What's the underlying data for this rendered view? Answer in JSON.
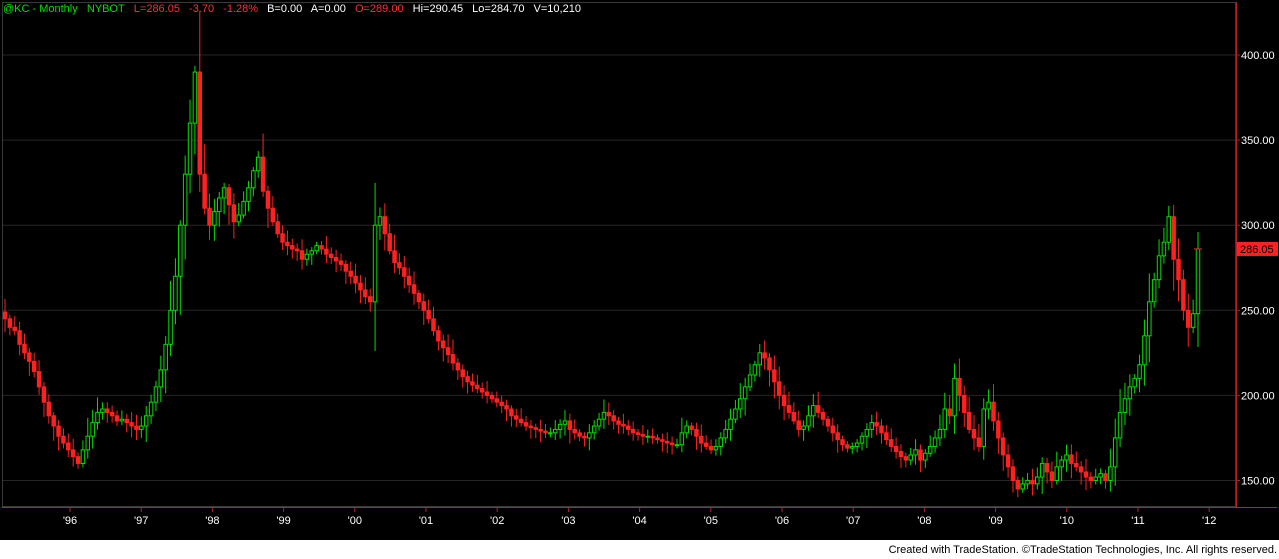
{
  "header": {
    "symbol": "@KC - Monthly",
    "exchange": "NYBOT",
    "last": "L=286.05",
    "change": "-3.70",
    "change_pct": "-1.28%",
    "bid": "B=0.00",
    "ask": "A=0.00",
    "open": "O=289.00",
    "high": "Hi=290.45",
    "low": "Lo=284.70",
    "volume": "V=10,210"
  },
  "footer": {
    "text": "Created with TradeStation. ©TradeStation Technologies, Inc. All rights reserved."
  },
  "colors": {
    "up": "#00e000",
    "down": "#ff2020",
    "axis": "#b22222",
    "grid": "#262626",
    "last_price_tag": "#ff2020"
  },
  "chart_data": {
    "type": "candlestick",
    "interval": "monthly",
    "ylim": [
      135,
      430
    ],
    "y_ticks": [
      150,
      200,
      250,
      300,
      350,
      400
    ],
    "y_tick_labels": [
      "150.00",
      "200.00",
      "250.00",
      "300.00",
      "350.00",
      "400.00"
    ],
    "x_tick_labels": [
      "'96",
      "'97",
      "'98",
      "'99",
      "'00",
      "'01",
      "'02",
      "'03",
      "'04",
      "'05",
      "'06",
      "'07",
      "'08",
      "'09",
      "'10",
      "'11",
      "'12"
    ],
    "last_price_label": "286.05",
    "last_price": 286.05,
    "closes": [
      245,
      240,
      238,
      230,
      225,
      220,
      214,
      205,
      196,
      188,
      182,
      176,
      172,
      168,
      164,
      160,
      168,
      176,
      184,
      190,
      192,
      190,
      188,
      185,
      186,
      184,
      182,
      180,
      182,
      188,
      196,
      205,
      215,
      230,
      250,
      270,
      300,
      330,
      360,
      390,
      330,
      310,
      300,
      308,
      316,
      322,
      312,
      302,
      306,
      314,
      322,
      332,
      340,
      320,
      310,
      302,
      295,
      290,
      288,
      286,
      285,
      280,
      283,
      285,
      288,
      286,
      283,
      281,
      279,
      277,
      273,
      270,
      266,
      262,
      258,
      255,
      300,
      305,
      295,
      285,
      278,
      275,
      270,
      265,
      260,
      255,
      250,
      245,
      238,
      232,
      228,
      224,
      219,
      215,
      211,
      208,
      206,
      204,
      202,
      200,
      198,
      196,
      194,
      192,
      188,
      186,
      184,
      182,
      181,
      180,
      179,
      178,
      178,
      180,
      183,
      185,
      180,
      178,
      176,
      175,
      178,
      182,
      186,
      190,
      188,
      185,
      183,
      182,
      180,
      178,
      177,
      176,
      176,
      175,
      174,
      173,
      172,
      171,
      171,
      178,
      182,
      180,
      176,
      172,
      170,
      168,
      170,
      175,
      180,
      186,
      192,
      198,
      205,
      212,
      218,
      225,
      222,
      215,
      208,
      200,
      194,
      190,
      185,
      180,
      182,
      188,
      194,
      190,
      186,
      182,
      178,
      174,
      171,
      169,
      170,
      172,
      176,
      180,
      184,
      182,
      178,
      174,
      170,
      167,
      164,
      162,
      165,
      168,
      162,
      166,
      170,
      175,
      180,
      192,
      188,
      210,
      200,
      190,
      180,
      175,
      170,
      192,
      196,
      185,
      175,
      165,
      158,
      150,
      145,
      148,
      150,
      148,
      152,
      160,
      155,
      150,
      158,
      162,
      165,
      160,
      158,
      155,
      152,
      150,
      152,
      154,
      150,
      158,
      175,
      190,
      198,
      205,
      210,
      218,
      235,
      255,
      268,
      282,
      290,
      305,
      280,
      268,
      250,
      240,
      248,
      286.05
    ]
  }
}
